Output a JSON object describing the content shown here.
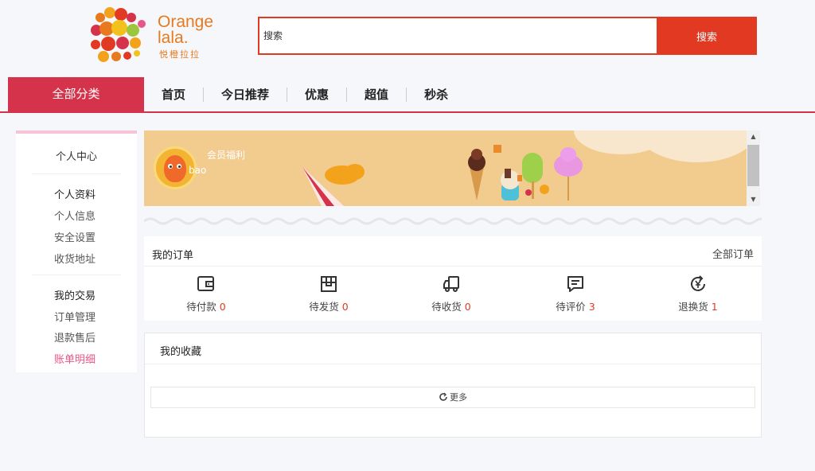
{
  "brand": {
    "name_line1": "Orange",
    "name_line2": "lala.",
    "name_cn": "悦橙拉拉"
  },
  "search": {
    "placeholder": "搜索",
    "button_label": "搜索"
  },
  "nav": {
    "all_categories": "全部分类",
    "items": [
      "首页",
      "今日推荐",
      "优惠",
      "超值",
      "秒杀"
    ]
  },
  "sidebar": {
    "title": "个人中心",
    "groups": [
      {
        "title": "个人资料",
        "items": [
          "个人信息",
          "安全设置",
          "收货地址"
        ]
      },
      {
        "title": "我的交易",
        "items": [
          "订单管理",
          "退款售后",
          "账单明细"
        ]
      }
    ],
    "active_item": "账单明细"
  },
  "banner": {
    "username": "bao",
    "member_label": "会员福利"
  },
  "orders": {
    "title": "我的订单",
    "all_link": "全部订单",
    "items": [
      {
        "label": "待付款",
        "count": "0",
        "icon": "wallet-icon"
      },
      {
        "label": "待发货",
        "count": "0",
        "icon": "package-icon"
      },
      {
        "label": "待收货",
        "count": "0",
        "icon": "truck-icon"
      },
      {
        "label": "待评价",
        "count": "3",
        "icon": "comment-icon"
      },
      {
        "label": "退换货",
        "count": "1",
        "icon": "refund-yen-icon"
      }
    ]
  },
  "favorites": {
    "title": "我的收藏",
    "more_label": "更多"
  },
  "colors": {
    "accent_red": "#e23a22",
    "nav_red": "#d4334b",
    "active_pink": "#e8558a",
    "logo_orange": "#e8791e",
    "banner_bg": "#f2cb8f"
  }
}
